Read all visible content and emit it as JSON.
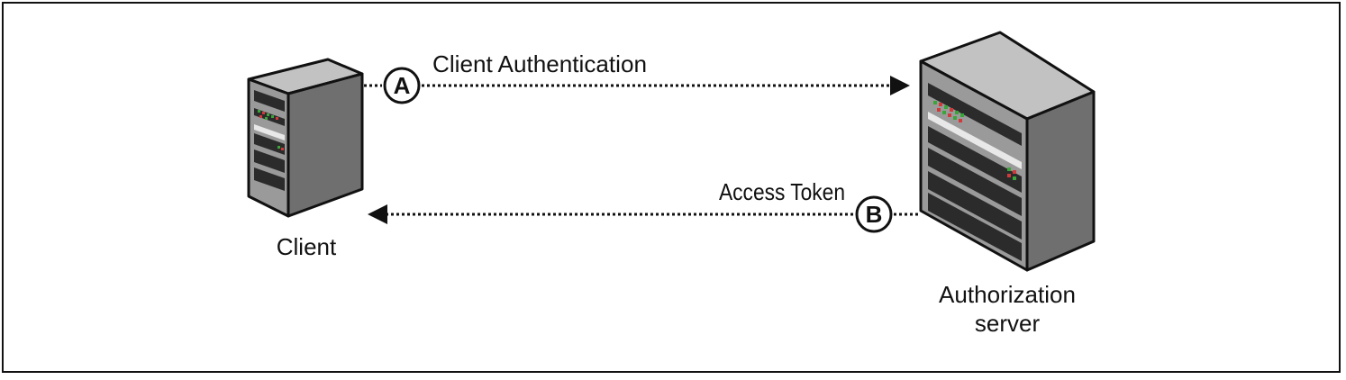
{
  "diagram": {
    "nodes": {
      "client": {
        "label": "Client"
      },
      "auth_server": {
        "label_line1": "Authorization",
        "label_line2": "server"
      }
    },
    "flows": [
      {
        "step": "A",
        "label": "Client Authentication",
        "direction": "client-to-server"
      },
      {
        "step": "B",
        "label": "Access Token",
        "direction": "server-to-client"
      }
    ],
    "colors": {
      "server_face": "#9a9a9a",
      "server_side": "#6f6f6f",
      "server_top": "#c2c2c2",
      "bay": "#2b2b2b",
      "led_green": "#3aa63a",
      "led_red": "#d13a3a",
      "line": "#111111"
    }
  }
}
